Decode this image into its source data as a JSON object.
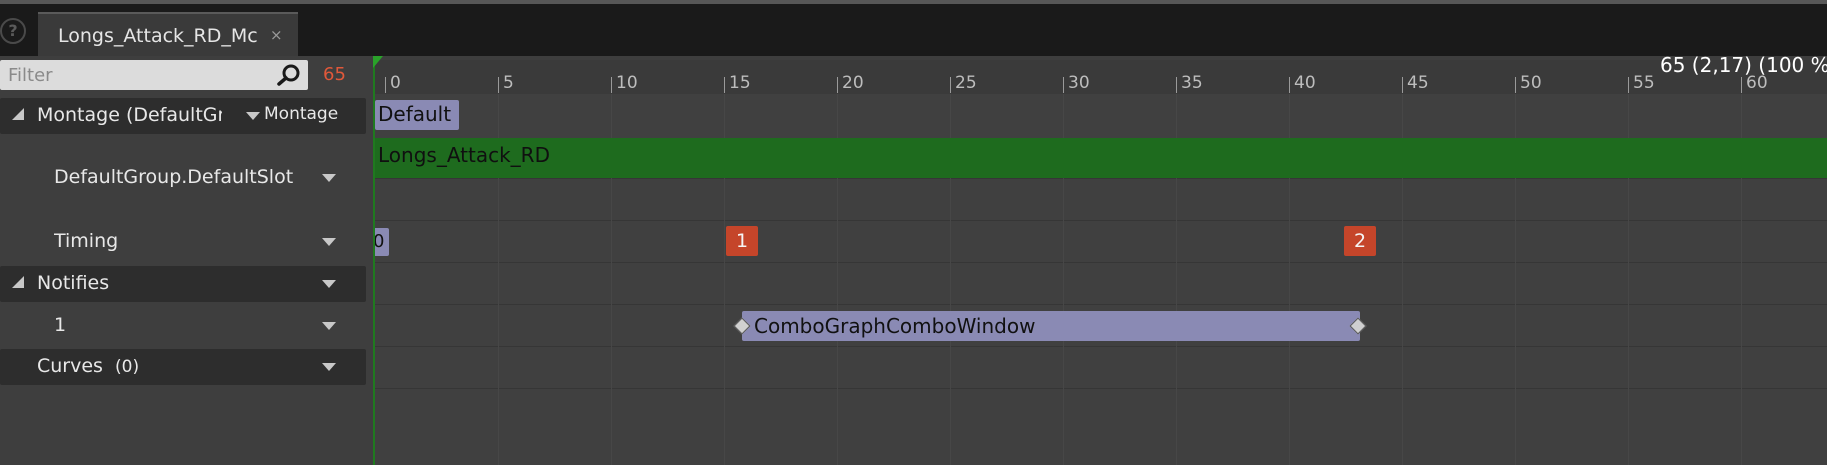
{
  "tab": {
    "title": "Longs_Attack_RD_Mc",
    "close": "×"
  },
  "filter": {
    "placeholder": "Filter",
    "frame_count": "65"
  },
  "tracks": {
    "montage": {
      "label": "Montage (DefaultGr",
      "dropdown": "Montage"
    },
    "slot": {
      "label": "DefaultGroup.DefaultSlot"
    },
    "timing": {
      "label": "Timing"
    },
    "notifies": {
      "label": "Notifies"
    },
    "notify_track": {
      "label": "1"
    },
    "curves": {
      "label": "Curves",
      "count": "(0)"
    }
  },
  "ruler": {
    "ticks": [
      "0",
      "5",
      "10",
      "15",
      "20",
      "25",
      "30",
      "35",
      "40",
      "45",
      "50",
      "55",
      "60"
    ],
    "timecode": "65 (2,17) (100 %"
  },
  "timeline": {
    "section": "Default",
    "slot_clip": "Longs_Attack_RD",
    "timing_zero": "0",
    "timing_markers": [
      "1",
      "2"
    ],
    "notify": "ComboGraphComboWindow"
  },
  "colors": {
    "accent_orange": "#e0583a",
    "slot_green": "#1e6b1e",
    "marker_red": "#c5452a",
    "section_purple": "#8a8ab4"
  }
}
